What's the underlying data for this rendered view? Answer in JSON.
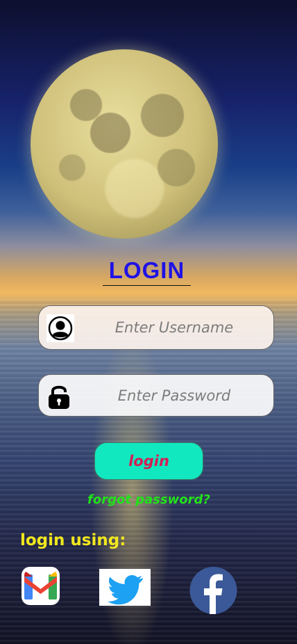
{
  "header": {
    "title": "LOGIN"
  },
  "form": {
    "username_placeholder": "Enter Username",
    "username_value": "",
    "password_placeholder": "Enter Password",
    "password_value": "",
    "login_label": "login",
    "forgot_label": "forgot password?"
  },
  "social": {
    "heading": "login using:",
    "providers": [
      "gmail-icon",
      "twitter-icon",
      "facebook-icon"
    ]
  },
  "colors": {
    "title": "#1f12e6",
    "login_button_bg": "#12e8c0",
    "login_button_text": "#d12056",
    "forgot_text": "#22e31a",
    "social_heading": "#f1e71e",
    "facebook": "#3b5998",
    "twitter": "#1da1f2"
  }
}
